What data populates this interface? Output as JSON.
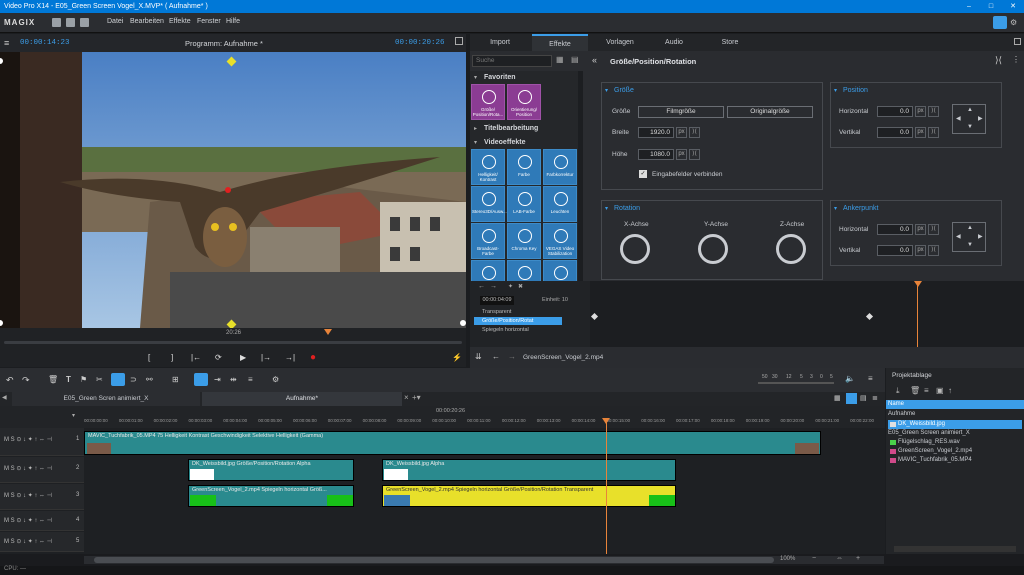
{
  "window": {
    "title": "Video Pro X14 - E05_Green Screen Vogel_X.MVP* ( Aufnahme* )",
    "controls": [
      "–",
      "□",
      "✕"
    ]
  },
  "menubar": {
    "logo": "MAGIX",
    "items": [
      "Datei",
      "Bearbeiten",
      "Effekte",
      "Fenster",
      "Hilfe"
    ]
  },
  "preview": {
    "time_left": "00:00:14:23",
    "title": "Programm: Aufnahme *",
    "time_right": "00:00:20:26",
    "scrub_time": "20:26",
    "transport": [
      "[",
      "]",
      "|←",
      "⟳",
      "▶",
      "|→",
      "→|",
      "●"
    ]
  },
  "right_panel": {
    "tabs": [
      "Import",
      "Effekte",
      "Vorlagen",
      "Audio",
      "Store"
    ],
    "active_tab": "Effekte",
    "search_placeholder": "Suche",
    "breadcrumb_title": "Größe/Position/Rotation",
    "categories": {
      "favoriten": "Favoriten",
      "titelbearbeitung": "Titelbearbeitung",
      "videoeffekte": "Videoeffekte"
    },
    "favorite_tiles": [
      "Größe/ Position/Rota...",
      "Orientierung/ Position"
    ],
    "effect_tiles": [
      "Helligkeit/ Kontrast",
      "Farbe",
      "Farbkorrektur",
      "Stereo3D/Ausw...",
      "LAB-Farbe",
      "Leuchten",
      "Broadcast-Farbe",
      "Chroma Key",
      "VEGAS Video Stabilization",
      "",
      "",
      ""
    ],
    "groesse": {
      "title": "Größe",
      "btn_film": "Filmgröße",
      "btn_orig": "Originalgröße",
      "label_size": "Größe",
      "label_width": "Breite",
      "label_height": "Höhe",
      "width": "1920.0",
      "height": "1080.0",
      "unit": "px",
      "link_label": "Eingabefelder verbinden"
    },
    "position": {
      "title": "Position",
      "label_h": "Horizontal",
      "label_v": "Vertikal",
      "h": "0.0",
      "v": "0.0",
      "unit": "px"
    },
    "rotation": {
      "title": "Rotation",
      "x": "X-Achse",
      "y": "Y-Achse",
      "z": "Z-Achse"
    },
    "anker": {
      "title": "Ankerpunkt",
      "label_h": "Horizontal",
      "label_v": "Vertikal",
      "h": "0.0",
      "v": "0.0",
      "unit": "px"
    },
    "keyframe": {
      "time": "00:00:04:09",
      "unit_label": "Einheit: 10",
      "rows": [
        "Transparent",
        "Größe/Position/Rotat",
        "Spiegeln horizontal"
      ]
    },
    "clip_name": "GreenScreen_Vogel_2.mp4"
  },
  "timeline": {
    "tabs": [
      "E05_Green Scren animiert_X",
      "Aufnahme*"
    ],
    "ruler_time": "00:00:20:26",
    "zoom_ticks": [
      "50",
      "30",
      "12",
      "5",
      "3",
      "0",
      "5"
    ],
    "ruler_labels": [
      "00:00:00:00",
      "00:00:01:00",
      "00:00:02:00",
      "00:00:03:00",
      "00:00:04:00",
      "00:00:05:00",
      "00:00:06:00",
      "00:00:07:00",
      "00:00:08:00",
      "00:00:09:00",
      "00:00:10:00",
      "00:00:11:00",
      "00:00:12:00",
      "00:00:13:00",
      "00:00:14:00",
      "00:00:15:00",
      "00:00:16:00",
      "00:00:17:00",
      "00:00:18:00",
      "00:00:19:00",
      "00:00:20:00",
      "00:00:21:00",
      "00:00:22:00"
    ],
    "track_ctrl": "M S ⊙ ↓ ✦ ↑ ⇔ ⊣",
    "track_numbers": [
      "1",
      "2",
      "3",
      "4",
      "5"
    ],
    "clips": [
      "MAVIC_Tuchfabrik_05.MP4  75  Helligkeit  Kontrast  Geschwindigkeit  Selektive Helligkeit (Gamma)",
      "DK_Weissbild.jpg  Größe/Position/Rotation  Alpha",
      "DK_Weissbild.jpg  Alpha",
      "GreenScreen_Vogel_2.mp4  Spiegeln horizontal  Größ...",
      "GreenScreen_Vogel_2.mp4  Spiegeln horizontal  Größe/Position/Rotation  Transparent"
    ],
    "zoom_level": "100%"
  },
  "project": {
    "title": "Projektablage",
    "column": "Name",
    "group": "Aufnahme",
    "items": [
      "DK_Weissbild.jpg",
      "E05_Green Screen animiert_X",
      "Flügelschlag_RES.wav",
      "GreenScreen_Vogel_2.mp4",
      "MAVIC_Tuchfabrik_05.MP4"
    ]
  },
  "status": {
    "cpu": "CPU: —"
  },
  "colors": {
    "accent": "#3b9de8",
    "teal_clip": "#2a8a8e",
    "yellow_clip": "#e8e02a",
    "effect_tile": "#2f7ab8",
    "favorite_tile": "#8b3c93",
    "playhead": "#e8843a"
  }
}
